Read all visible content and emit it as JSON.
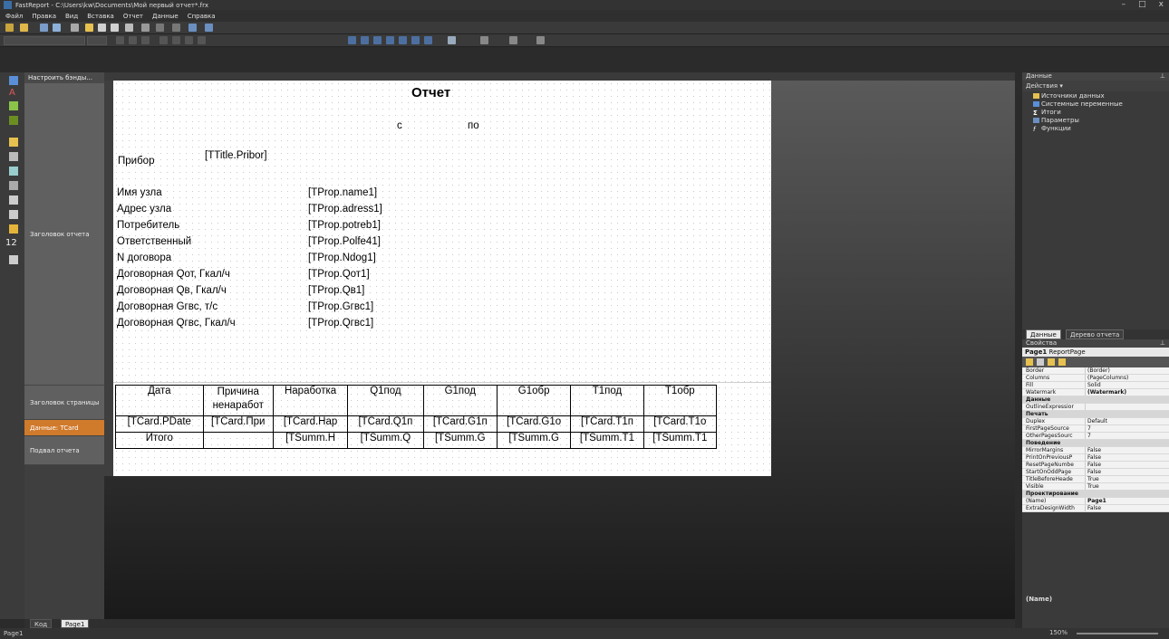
{
  "window": {
    "title": "FastReport - C:\\Users\\kw\\Documents\\Мой первый отчет*.frx",
    "controls": [
      "–",
      "□",
      "x"
    ]
  },
  "menu": [
    "Файл",
    "Правка",
    "Вид",
    "Вставка",
    "Отчет",
    "Данные",
    "Справка"
  ],
  "bands_panel": {
    "configure_label": "Настроить бэнды...",
    "bands": [
      {
        "label": "Заголовок отчета",
        "selected": false
      },
      {
        "label": "Заголовок страницы",
        "selected": false
      },
      {
        "label": "Данные: TCard",
        "selected": true
      },
      {
        "label": "Подвал отчета",
        "selected": false
      }
    ]
  },
  "left_tools": {
    "number_label": "12"
  },
  "report": {
    "title": "Отчет",
    "period_from": "с",
    "period_to": "по",
    "device_label": "Прибор",
    "device_value": "[TTitle.Pribor]",
    "info_rows": [
      {
        "label": "Имя узла",
        "value": "[TProp.name1]"
      },
      {
        "label": "Адрес узла",
        "value": "[TProp.adress1]"
      },
      {
        "label": "Потребитель",
        "value": "[TProp.potreb1]"
      },
      {
        "label": "Ответственный",
        "value": "[TProp.Polfe41]"
      },
      {
        "label": "N договора",
        "value": "[TProp.Ndog1]"
      },
      {
        "label": "Договорная Qот, Гкал/ч",
        "value": "[TProp.Qот1]"
      },
      {
        "label": "Договорная Qв, Гкал/ч",
        "value": "[TProp.Qв1]"
      },
      {
        "label": "Договорная Gгвс, т/с",
        "value": "[TProp.Gгвс1]"
      },
      {
        "label": "Договорная Qгвс, Гкал/ч",
        "value": "[TProp.Qгвс1]"
      }
    ],
    "table_headers": [
      "Дата",
      "Причина\nненаработ",
      "Наработка",
      "Q1под",
      "G1под",
      "G1обр",
      "T1под",
      "T1обр"
    ],
    "data_row": [
      "[TCard.PDate",
      "[TCard.При",
      "[TCard.Нар",
      "[TCard.Q1п",
      "[TCard.G1п",
      "[TCard.G1о",
      "[TCard.T1п",
      "[TCard.T1о"
    ],
    "summary_row": [
      "Итого",
      "",
      "[TSumm.H",
      "[TSumm.Q",
      "[TSumm.G",
      "[TSumm.G",
      "[TSumm.T1",
      "[TSumm.T1"
    ]
  },
  "bottom_tabs": [
    "Код",
    "Page1"
  ],
  "status": {
    "text": "Page1",
    "zoom": "150%"
  },
  "data_panel": {
    "title": "Данные",
    "actions_label": "Действия",
    "tree": [
      {
        "label": "Источники данных",
        "icon": "folder-icon"
      },
      {
        "label": "Системные переменные",
        "icon": "table-icon"
      },
      {
        "label": "Итоги",
        "icon": "sum-icon"
      },
      {
        "label": "Параметры",
        "icon": "param-icon"
      },
      {
        "label": "Функции",
        "icon": "function-icon"
      }
    ],
    "tabs": [
      "Данные",
      "Дерево отчета"
    ]
  },
  "properties_panel": {
    "title": "Свойства",
    "object_name": "Page1",
    "object_type": "ReportPage",
    "rows": [
      {
        "name": "Border",
        "value": "(Border)",
        "category": false
      },
      {
        "name": "Columns",
        "value": "(PageColumns)",
        "category": false
      },
      {
        "name": "Fill",
        "value": "Solid",
        "category": false
      },
      {
        "name": "Watermark",
        "value": "(Watermark)",
        "category": false
      },
      {
        "name": "Данные",
        "value": "",
        "category": true
      },
      {
        "name": "OutlineExpressior",
        "value": "",
        "category": false
      },
      {
        "name": "Печать",
        "value": "",
        "category": true
      },
      {
        "name": "Duplex",
        "value": "Default",
        "category": false
      },
      {
        "name": "FirstPageSource",
        "value": "7",
        "category": false
      },
      {
        "name": "OtherPagesSourc",
        "value": "7",
        "category": false
      },
      {
        "name": "Поведение",
        "value": "",
        "category": true
      },
      {
        "name": "MirrorMargins",
        "value": "False",
        "category": false
      },
      {
        "name": "PrintOnPreviousP",
        "value": "False",
        "category": false
      },
      {
        "name": "ResetPageNumbe",
        "value": "False",
        "category": false
      },
      {
        "name": "StartOnOddPage",
        "value": "False",
        "category": false
      },
      {
        "name": "TitleBeforeHeade",
        "value": "True",
        "category": false
      },
      {
        "name": "Visible",
        "value": "True",
        "category": false
      },
      {
        "name": "Проектирование",
        "value": "",
        "category": true
      },
      {
        "name": "(Name)",
        "value": "Page1",
        "category": false
      },
      {
        "name": "ExtraDesignWidth",
        "value": "False",
        "category": false
      }
    ],
    "description_title": "(Name)"
  },
  "colors": {
    "accent": "#d07a2c",
    "page": "#ffffff",
    "chrome": "#3a3a3a"
  }
}
